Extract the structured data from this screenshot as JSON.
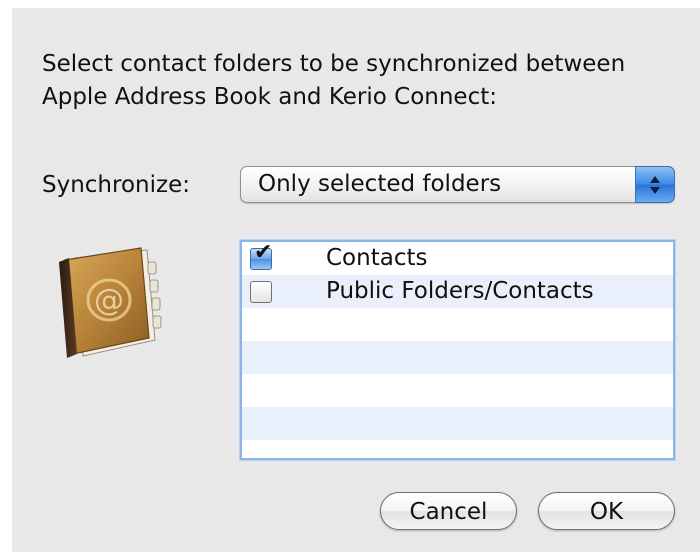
{
  "dialog": {
    "prompt_line1": "Select contact folders to be synchronized between",
    "prompt_line2": "Apple Address Book and Kerio Connect:"
  },
  "synchronize": {
    "label": "Synchronize:",
    "selected_value": "Only selected folders"
  },
  "icon": {
    "name": "address-book-icon",
    "symbol": "@"
  },
  "folders": [
    {
      "label": "Contacts",
      "checked": true
    },
    {
      "label": "Public Folders/Contacts",
      "checked": false
    }
  ],
  "buttons": {
    "cancel_label": "Cancel",
    "ok_label": "OK"
  },
  "colors": {
    "background": "#e8e8e8",
    "list_focus_ring": "#8cb4e6",
    "list_alt_row": "#e9f0fb",
    "accent_blue": "#3a88e6"
  }
}
